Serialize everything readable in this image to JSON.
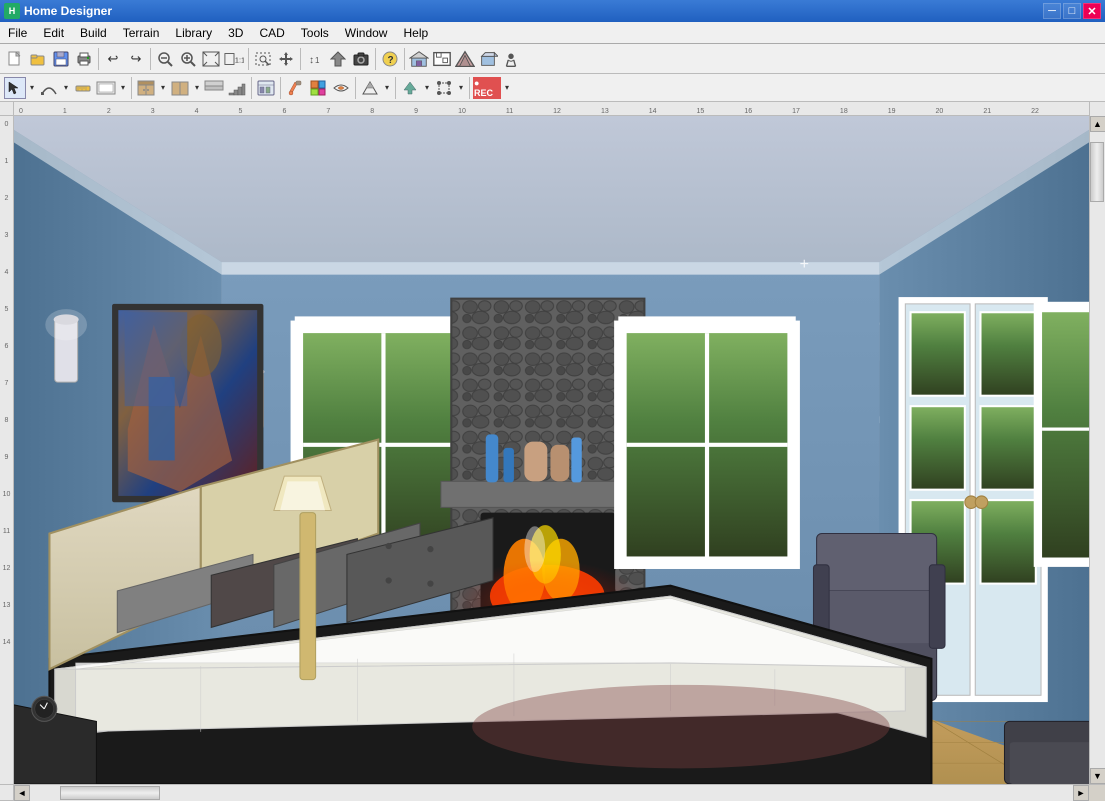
{
  "window": {
    "title": "Home Designer",
    "icon": "HD"
  },
  "titlebar": {
    "controls": [
      "─",
      "□",
      "✕"
    ]
  },
  "menubar": {
    "items": [
      {
        "id": "file",
        "label": "File"
      },
      {
        "id": "edit",
        "label": "Edit"
      },
      {
        "id": "build",
        "label": "Build"
      },
      {
        "id": "terrain",
        "label": "Terrain"
      },
      {
        "id": "library",
        "label": "Library"
      },
      {
        "id": "3d",
        "label": "3D"
      },
      {
        "id": "cad",
        "label": "CAD"
      },
      {
        "id": "tools",
        "label": "Tools"
      },
      {
        "id": "window",
        "label": "Window"
      },
      {
        "id": "help",
        "label": "Help"
      }
    ]
  },
  "toolbar1": {
    "buttons": [
      "new",
      "open",
      "save",
      "print",
      "undo",
      "redo",
      "zoom-out",
      "zoom-in",
      "zoom-fit",
      "zoom-real",
      "camera",
      "help",
      "separator",
      "exterior",
      "floor",
      "roof",
      "house",
      "fence"
    ]
  },
  "toolbar2": {
    "buttons": [
      "select",
      "draw-line",
      "tape",
      "view",
      "cabinet",
      "cabinet2",
      "soffit",
      "stair",
      "library",
      "paint",
      "material",
      "spray",
      "separator",
      "wall-type",
      "wall-dropdown",
      "separator",
      "dimension",
      "elevation",
      "arrow",
      "text",
      "record"
    ]
  },
  "viewport": {
    "scene": "3D bedroom interior with fireplace, bed, windows, and french doors",
    "description": "A luxurious bedroom with blue-gray walls, wood flooring, stone fireplace, large bed with pillows, windows showing forest outside, and french doors"
  },
  "scrollbars": {
    "vertical": {
      "position": 10
    },
    "horizontal": {
      "position": 30
    }
  },
  "status": {
    "text": ""
  }
}
